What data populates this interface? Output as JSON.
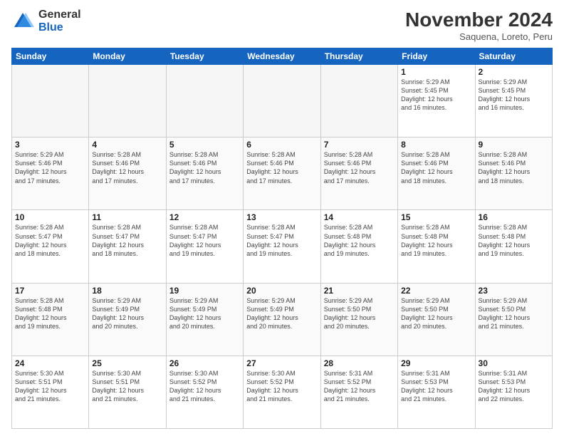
{
  "logo": {
    "general": "General",
    "blue": "Blue"
  },
  "header": {
    "month": "November 2024",
    "location": "Saquena, Loreto, Peru"
  },
  "weekdays": [
    "Sunday",
    "Monday",
    "Tuesday",
    "Wednesday",
    "Thursday",
    "Friday",
    "Saturday"
  ],
  "weeks": [
    [
      {
        "day": "",
        "info": ""
      },
      {
        "day": "",
        "info": ""
      },
      {
        "day": "",
        "info": ""
      },
      {
        "day": "",
        "info": ""
      },
      {
        "day": "",
        "info": ""
      },
      {
        "day": "1",
        "info": "Sunrise: 5:29 AM\nSunset: 5:45 PM\nDaylight: 12 hours\nand 16 minutes."
      },
      {
        "day": "2",
        "info": "Sunrise: 5:29 AM\nSunset: 5:45 PM\nDaylight: 12 hours\nand 16 minutes."
      }
    ],
    [
      {
        "day": "3",
        "info": "Sunrise: 5:29 AM\nSunset: 5:46 PM\nDaylight: 12 hours\nand 17 minutes."
      },
      {
        "day": "4",
        "info": "Sunrise: 5:28 AM\nSunset: 5:46 PM\nDaylight: 12 hours\nand 17 minutes."
      },
      {
        "day": "5",
        "info": "Sunrise: 5:28 AM\nSunset: 5:46 PM\nDaylight: 12 hours\nand 17 minutes."
      },
      {
        "day": "6",
        "info": "Sunrise: 5:28 AM\nSunset: 5:46 PM\nDaylight: 12 hours\nand 17 minutes."
      },
      {
        "day": "7",
        "info": "Sunrise: 5:28 AM\nSunset: 5:46 PM\nDaylight: 12 hours\nand 17 minutes."
      },
      {
        "day": "8",
        "info": "Sunrise: 5:28 AM\nSunset: 5:46 PM\nDaylight: 12 hours\nand 18 minutes."
      },
      {
        "day": "9",
        "info": "Sunrise: 5:28 AM\nSunset: 5:46 PM\nDaylight: 12 hours\nand 18 minutes."
      }
    ],
    [
      {
        "day": "10",
        "info": "Sunrise: 5:28 AM\nSunset: 5:47 PM\nDaylight: 12 hours\nand 18 minutes."
      },
      {
        "day": "11",
        "info": "Sunrise: 5:28 AM\nSunset: 5:47 PM\nDaylight: 12 hours\nand 18 minutes."
      },
      {
        "day": "12",
        "info": "Sunrise: 5:28 AM\nSunset: 5:47 PM\nDaylight: 12 hours\nand 19 minutes."
      },
      {
        "day": "13",
        "info": "Sunrise: 5:28 AM\nSunset: 5:47 PM\nDaylight: 12 hours\nand 19 minutes."
      },
      {
        "day": "14",
        "info": "Sunrise: 5:28 AM\nSunset: 5:48 PM\nDaylight: 12 hours\nand 19 minutes."
      },
      {
        "day": "15",
        "info": "Sunrise: 5:28 AM\nSunset: 5:48 PM\nDaylight: 12 hours\nand 19 minutes."
      },
      {
        "day": "16",
        "info": "Sunrise: 5:28 AM\nSunset: 5:48 PM\nDaylight: 12 hours\nand 19 minutes."
      }
    ],
    [
      {
        "day": "17",
        "info": "Sunrise: 5:28 AM\nSunset: 5:48 PM\nDaylight: 12 hours\nand 19 minutes."
      },
      {
        "day": "18",
        "info": "Sunrise: 5:29 AM\nSunset: 5:49 PM\nDaylight: 12 hours\nand 20 minutes."
      },
      {
        "day": "19",
        "info": "Sunrise: 5:29 AM\nSunset: 5:49 PM\nDaylight: 12 hours\nand 20 minutes."
      },
      {
        "day": "20",
        "info": "Sunrise: 5:29 AM\nSunset: 5:49 PM\nDaylight: 12 hours\nand 20 minutes."
      },
      {
        "day": "21",
        "info": "Sunrise: 5:29 AM\nSunset: 5:50 PM\nDaylight: 12 hours\nand 20 minutes."
      },
      {
        "day": "22",
        "info": "Sunrise: 5:29 AM\nSunset: 5:50 PM\nDaylight: 12 hours\nand 20 minutes."
      },
      {
        "day": "23",
        "info": "Sunrise: 5:29 AM\nSunset: 5:50 PM\nDaylight: 12 hours\nand 21 minutes."
      }
    ],
    [
      {
        "day": "24",
        "info": "Sunrise: 5:30 AM\nSunset: 5:51 PM\nDaylight: 12 hours\nand 21 minutes."
      },
      {
        "day": "25",
        "info": "Sunrise: 5:30 AM\nSunset: 5:51 PM\nDaylight: 12 hours\nand 21 minutes."
      },
      {
        "day": "26",
        "info": "Sunrise: 5:30 AM\nSunset: 5:52 PM\nDaylight: 12 hours\nand 21 minutes."
      },
      {
        "day": "27",
        "info": "Sunrise: 5:30 AM\nSunset: 5:52 PM\nDaylight: 12 hours\nand 21 minutes."
      },
      {
        "day": "28",
        "info": "Sunrise: 5:31 AM\nSunset: 5:52 PM\nDaylight: 12 hours\nand 21 minutes."
      },
      {
        "day": "29",
        "info": "Sunrise: 5:31 AM\nSunset: 5:53 PM\nDaylight: 12 hours\nand 21 minutes."
      },
      {
        "day": "30",
        "info": "Sunrise: 5:31 AM\nSunset: 5:53 PM\nDaylight: 12 hours\nand 22 minutes."
      }
    ]
  ]
}
